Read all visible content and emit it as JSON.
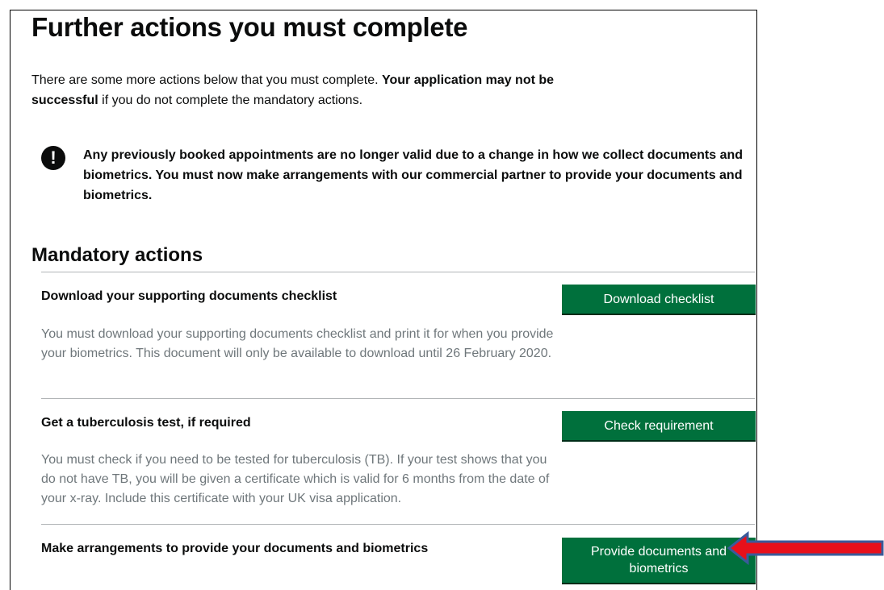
{
  "page": {
    "title": "Further actions you must complete",
    "intro_part1": "There are some more actions below that you must complete. ",
    "intro_bold": "Your application may not be successful",
    "intro_part2": " if you do not complete the mandatory actions."
  },
  "warning": {
    "icon": "exclamation-icon",
    "icon_glyph": "!",
    "text": "Any previously booked appointments are no longer valid due to a change in how we collect documents and biometrics. You must now make arrangements with our commercial partner to provide your documents and biometrics."
  },
  "mandatory": {
    "title": "Mandatory actions",
    "actions": [
      {
        "title": "Download your supporting documents checklist",
        "description": "You must download your supporting documents checklist and print it for when you provide your biometrics. This document will only be available to download until 26 February 2020.",
        "button": "Download checklist"
      },
      {
        "title": "Get a tuberculosis test, if required",
        "description": "You must check if you need to be tested for tuberculosis (TB). If your test shows that you do not have TB, you will be given a certificate which is valid for 6 months from the date of your x-ray. Include this certificate with your UK visa application.",
        "button": "Check requirement"
      },
      {
        "title": "Make arrangements to provide your documents and biometrics",
        "button": "Provide documents and biometrics"
      }
    ]
  },
  "colors": {
    "button_green": "#00703c",
    "button_shadow": "#002d18",
    "arrow_fill": "#e8101b",
    "arrow_outline": "#3b5a9a",
    "divider": "#b1b4b6",
    "secondary_text": "#6f777b"
  },
  "annotation": {
    "icon": "arrow-left-icon"
  }
}
